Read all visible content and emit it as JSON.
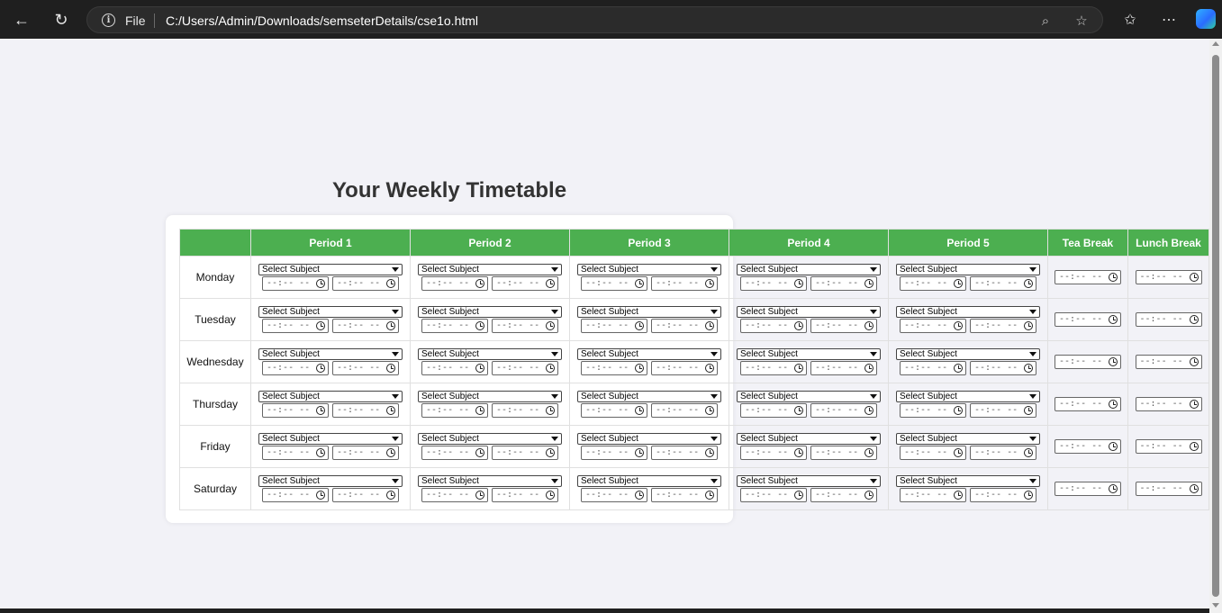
{
  "browser": {
    "file_label": "File",
    "url": "C:/Users/Admin/Downloads/semseterDetails/cse1o.html"
  },
  "page": {
    "title": "Your Weekly Timetable"
  },
  "table": {
    "headers": [
      "",
      "Period 1",
      "Period 2",
      "Period 3",
      "Period 4",
      "Period 5",
      "Tea Break",
      "Lunch Break"
    ],
    "days": [
      "Monday",
      "Tuesday",
      "Wednesday",
      "Thursday",
      "Friday",
      "Saturday"
    ],
    "select_value": "Select Subject",
    "time_placeholder": "--:-- --"
  }
}
